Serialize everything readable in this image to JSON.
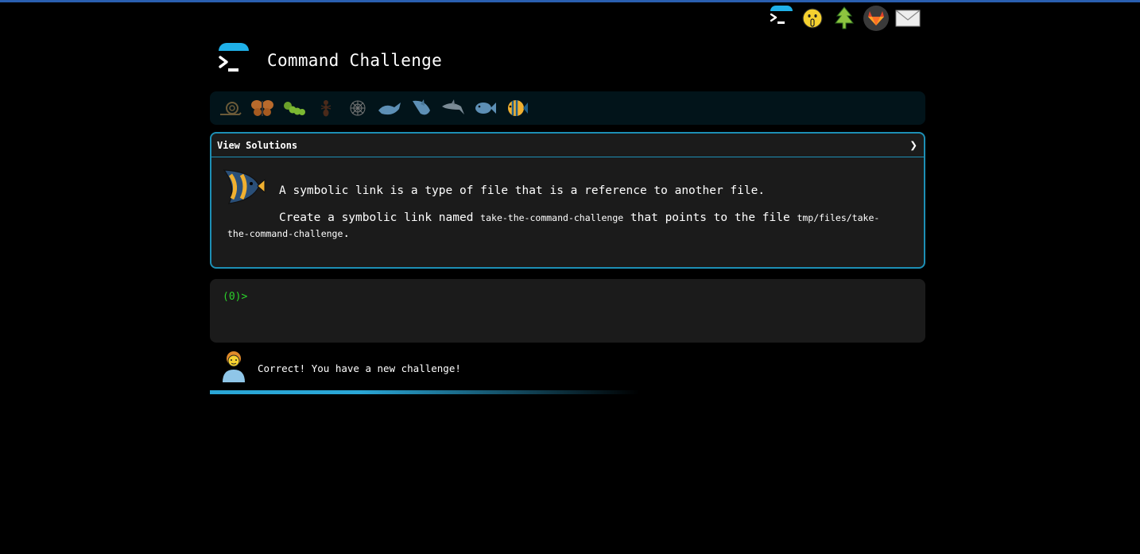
{
  "header": {
    "title": "Command Challenge"
  },
  "top_nav": {
    "icons": [
      "terminal-logo-icon",
      "shushing-face-icon",
      "evergreen-tree-icon",
      "gitlab-icon",
      "envelope-icon"
    ],
    "emoji_face": "🤫",
    "emoji_tree": "🌲",
    "emoji_mail": "✉"
  },
  "levels": [
    "snail",
    "butterfly",
    "caterpillar",
    "ant",
    "spider-web",
    "whale",
    "shark",
    "dolphin",
    "fish",
    "tropical-fish"
  ],
  "challenge": {
    "solutions_label": "View Solutions",
    "chevron": "❯",
    "line1": "A symbolic link is a type of file that is a reference to another file.",
    "line2_a": "Create a symbolic link named ",
    "line2_code1": "take-the-command-challenge",
    "line2_b": " that points to the file ",
    "line2_code2": "tmp/files/take-the-command-challenge",
    "line2_c": "."
  },
  "terminal": {
    "prompt": "(0)>"
  },
  "status": {
    "message": "Correct! You have a new challenge!",
    "progress_fraction": 0.6
  },
  "colors": {
    "accent": "#1fb0e8",
    "border": "#1d8fb5",
    "prompt": "#2bd12b",
    "panel": "#1b1b1b"
  }
}
